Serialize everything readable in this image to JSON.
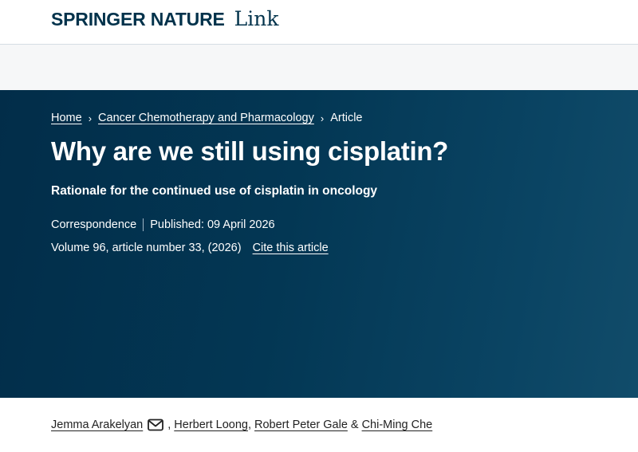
{
  "header": {
    "brand": "SPRINGER NATURE",
    "product": "Link"
  },
  "breadcrumb": {
    "home": "Home",
    "journal": "Cancer Chemotherapy and Pharmacology",
    "current": "Article",
    "separator": "›"
  },
  "article": {
    "title": "Why are we still using cisplatin?",
    "subtitle": "Rationale for the continued use of cisplatin in oncology",
    "type": "Correspondence",
    "published": "Published: 09 April 2026",
    "volume": "Volume 96, article number 33, (2026)",
    "cite_label": "Cite this article"
  },
  "authors": {
    "author_1": "Jemma Arakelyan",
    "author_2": "Herbert Loong",
    "author_3": "Robert Peter Gale",
    "author_4": "Chi-Ming Che",
    "comma": ",",
    "ampersand": "&"
  },
  "colors": {
    "brand_navy": "#01324b",
    "hero_bg": "#033754"
  },
  "icons": {
    "email": "envelope-icon"
  }
}
